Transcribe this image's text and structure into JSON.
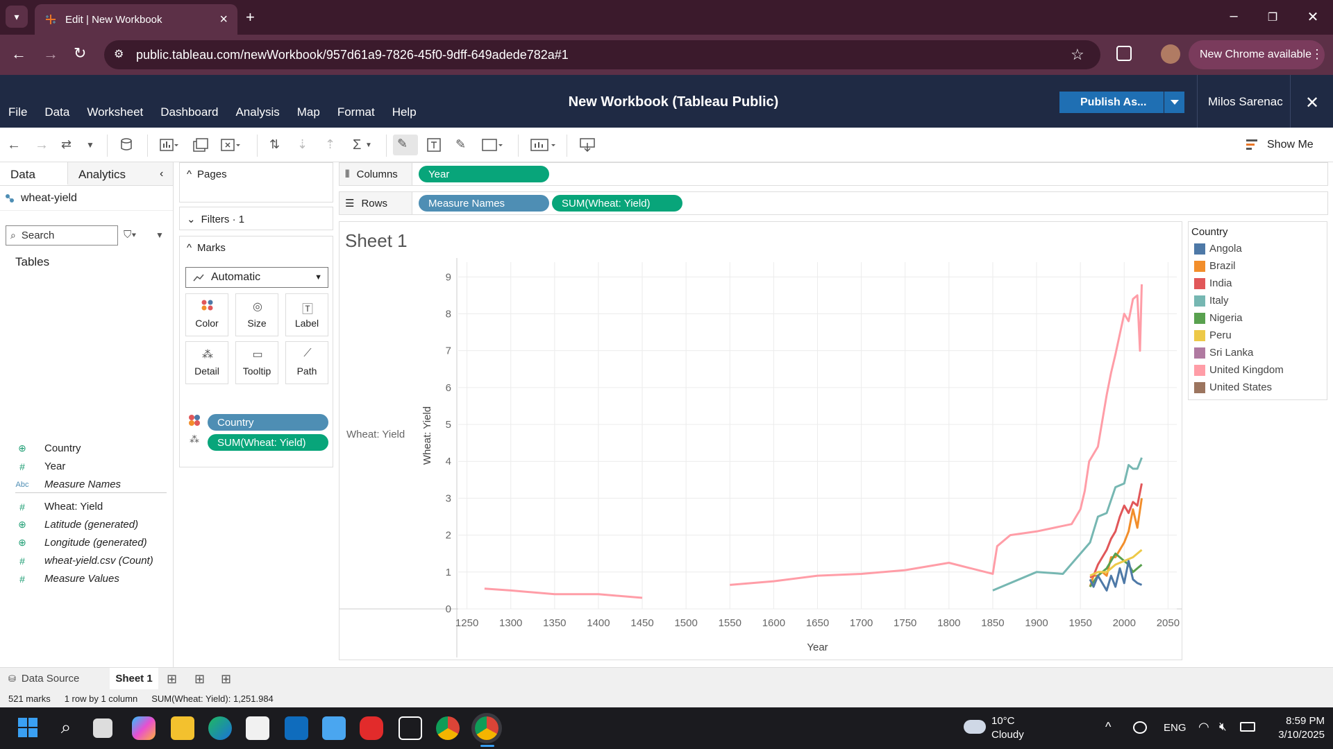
{
  "browser": {
    "tab_title": "Edit | New Workbook",
    "url": "public.tableau.com/newWorkbook/957d61a9-7826-45f0-9dff-649adede782a#1",
    "new_chrome": "New Chrome available"
  },
  "header": {
    "menu": [
      "File",
      "Data",
      "Worksheet",
      "Dashboard",
      "Analysis",
      "Map",
      "Format",
      "Help"
    ],
    "title": "New Workbook (Tableau Public)",
    "publish": "Publish As...",
    "user": "Milos Sarenac"
  },
  "toolbar": {
    "show_me": "Show Me"
  },
  "data_pane": {
    "tabs": [
      "Data",
      "Analytics"
    ],
    "datasource": "wheat-yield",
    "search_placeholder": "Search",
    "tables_label": "Tables",
    "fields": [
      {
        "icon": "globe",
        "name": "Country",
        "italic": false
      },
      {
        "icon": "#",
        "name": "Year",
        "italic": false
      },
      {
        "icon": "Abc",
        "name": "Measure Names",
        "italic": true
      },
      {
        "icon": "#",
        "name": "Wheat: Yield",
        "italic": false
      },
      {
        "icon": "globe",
        "name": "Latitude (generated)",
        "italic": true
      },
      {
        "icon": "globe",
        "name": "Longitude (generated)",
        "italic": true
      },
      {
        "icon": "#",
        "name": "wheat-yield.csv (Count)",
        "italic": true
      },
      {
        "icon": "#",
        "name": "Measure Values",
        "italic": true
      }
    ]
  },
  "cards": {
    "pages": "Pages",
    "filters": "Filters · 1",
    "marks": "Marks",
    "mark_type": "Automatic",
    "buttons": [
      "Color",
      "Size",
      "Label",
      "Detail",
      "Tooltip",
      "Path"
    ],
    "mark_pills": [
      "Country",
      "SUM(Wheat: Yield)"
    ]
  },
  "shelves": {
    "columns_label": "Columns",
    "rows_label": "Rows",
    "columns_pills": [
      "Year"
    ],
    "rows_pills": [
      "Measure Names",
      "SUM(Wheat: Yield)"
    ]
  },
  "view": {
    "sheet_title": "Sheet 1",
    "row_header": "Wheat: Yield"
  },
  "chart_data": {
    "type": "line",
    "xlabel": "Year",
    "ylabel": "Wheat: Yield",
    "xlim": [
      1240,
      2060
    ],
    "ylim": [
      0,
      9.4
    ],
    "x_ticks": [
      1250,
      1300,
      1350,
      1400,
      1450,
      1500,
      1550,
      1600,
      1650,
      1700,
      1750,
      1800,
      1850,
      1900,
      1950,
      2000,
      2050
    ],
    "y_ticks": [
      0,
      1,
      2,
      3,
      4,
      5,
      6,
      7,
      8,
      9
    ],
    "grid": true,
    "legend_title": "Country",
    "series": [
      {
        "name": "Angola",
        "color": "#4e79a7",
        "x": [
          1961,
          1965,
          1970,
          1975,
          1980,
          1985,
          1990,
          1995,
          2000,
          2005,
          2010,
          2015,
          2020
        ],
        "y": [
          0.8,
          0.6,
          0.9,
          0.7,
          0.5,
          0.9,
          0.6,
          1.1,
          0.7,
          1.3,
          0.8,
          0.7,
          0.65
        ]
      },
      {
        "name": "Brazil",
        "color": "#f28e2b",
        "x": [
          1961,
          1965,
          1970,
          1975,
          1980,
          1985,
          1990,
          1995,
          2000,
          2005,
          2010,
          2015,
          2020
        ],
        "y": [
          0.6,
          0.9,
          0.9,
          1.0,
          0.9,
          1.4,
          1.4,
          1.6,
          1.8,
          2.1,
          2.7,
          2.2,
          3.0
        ]
      },
      {
        "name": "India",
        "color": "#e15759",
        "x": [
          1961,
          1965,
          1970,
          1975,
          1980,
          1985,
          1990,
          1995,
          2000,
          2005,
          2010,
          2015,
          2020
        ],
        "y": [
          0.85,
          0.9,
          1.2,
          1.4,
          1.6,
          1.9,
          2.1,
          2.5,
          2.8,
          2.6,
          2.9,
          2.8,
          3.4
        ]
      },
      {
        "name": "Italy",
        "color": "#76b7b2",
        "x": [
          1850,
          1900,
          1930,
          1961,
          1970,
          1980,
          1990,
          2000,
          2005,
          2010,
          2015,
          2020
        ],
        "y": [
          0.5,
          1.0,
          0.95,
          1.8,
          2.5,
          2.6,
          3.3,
          3.4,
          3.9,
          3.8,
          3.8,
          4.1
        ]
      },
      {
        "name": "Nigeria",
        "color": "#59a14f",
        "x": [
          1961,
          1970,
          1980,
          1990,
          2000,
          2005,
          2010,
          2015,
          2020
        ],
        "y": [
          0.6,
          0.9,
          1.1,
          1.5,
          1.3,
          1.2,
          1.0,
          1.1,
          1.2
        ]
      },
      {
        "name": "Peru",
        "color": "#edc948",
        "x": [
          1961,
          1970,
          1980,
          1990,
          2000,
          2010,
          2020
        ],
        "y": [
          0.9,
          1.0,
          1.0,
          1.2,
          1.3,
          1.4,
          1.6
        ]
      },
      {
        "name": "Sri Lanka",
        "color": "#b07aa1",
        "x": [],
        "y": []
      },
      {
        "name": "United Kingdom",
        "color": "#ff9da7",
        "x": [
          1270,
          1300,
          1350,
          1400,
          1450,
          1550,
          1600,
          1650,
          1700,
          1750,
          1800,
          1850,
          1855,
          1870,
          1900,
          1920,
          1940,
          1950,
          1955,
          1960,
          1970,
          1980,
          1985,
          1990,
          2000,
          2005,
          2010,
          2015,
          2018,
          2020
        ],
        "y": [
          0.55,
          0.5,
          0.4,
          0.4,
          0.3,
          0.65,
          0.75,
          0.9,
          0.95,
          1.05,
          1.25,
          0.95,
          1.7,
          2.0,
          2.1,
          2.2,
          2.3,
          2.7,
          3.2,
          4.0,
          4.4,
          5.8,
          6.4,
          6.9,
          8.0,
          7.8,
          8.4,
          8.5,
          7.0,
          8.8
        ]
      },
      {
        "name": "United States",
        "color": "#9c755f",
        "x": [],
        "y": []
      }
    ]
  },
  "bottom": {
    "data_source_tab": "Data Source",
    "sheet_tab": "Sheet 1",
    "status_marks": "521 marks",
    "status_dims": "1 row by 1 column",
    "status_sum": "SUM(Wheat: Yield): 1,251.984"
  },
  "taskbar": {
    "weather_temp": "10°C",
    "weather_desc": "Cloudy",
    "lang": "ENG",
    "time": "8:59 PM",
    "date": "3/10/2025"
  }
}
